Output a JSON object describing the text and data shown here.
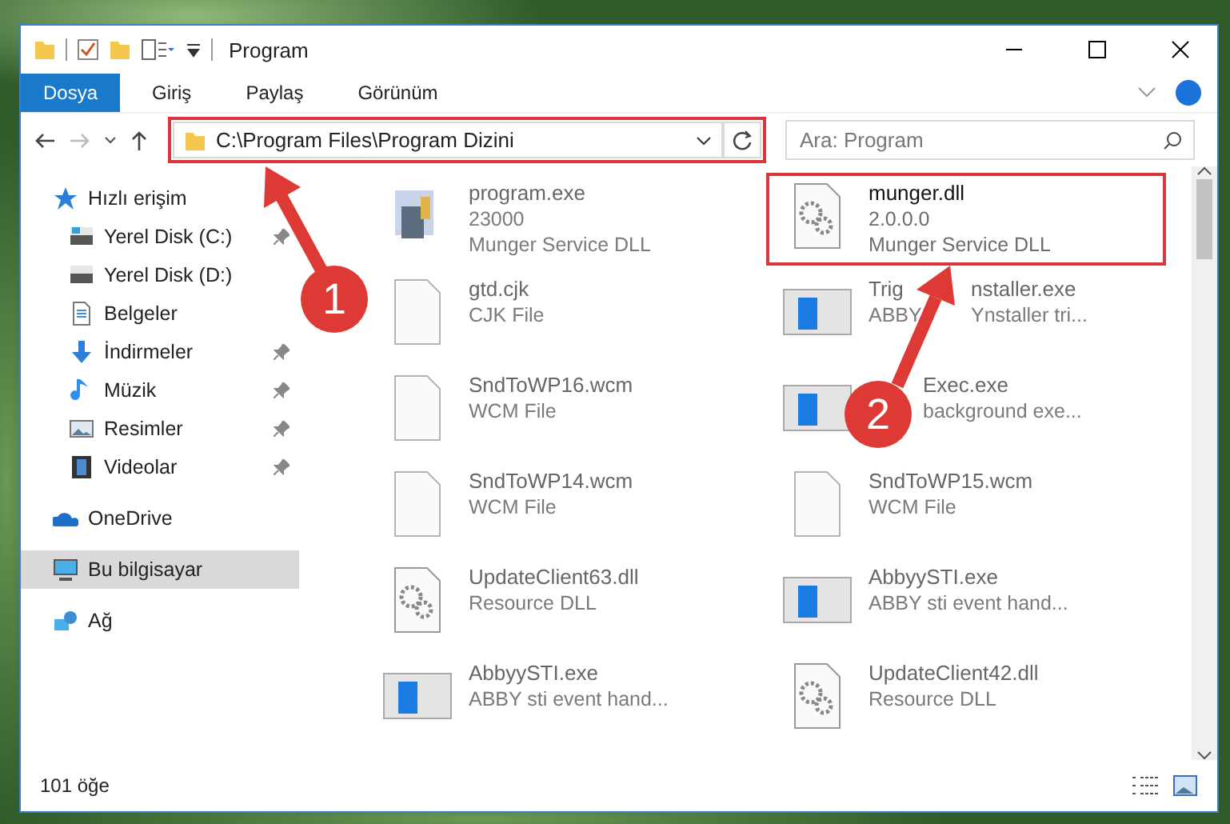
{
  "window": {
    "title": "Program"
  },
  "ribbon_tabs": [
    {
      "label": "Dosya",
      "selected": true
    },
    {
      "label": "Giriş",
      "selected": false
    },
    {
      "label": "Paylaş",
      "selected": false
    },
    {
      "label": "Görünüm",
      "selected": false
    }
  ],
  "address": {
    "path": "C:\\Program Files\\Program Dizini",
    "highlighted": true
  },
  "search": {
    "placeholder": "Ara: Program"
  },
  "sidebar": {
    "items": [
      {
        "label": "Hızlı erişim",
        "kind": "star",
        "selected": false,
        "children": [
          {
            "label": "Yerel Disk (C:)",
            "kind": "drive-c",
            "pinned": true,
            "selected": false
          },
          {
            "label": "Yerel Disk (D:)",
            "kind": "drive",
            "pinned": false,
            "selected": false
          },
          {
            "label": "Belgeler",
            "kind": "docs",
            "pinned": false,
            "selected": false
          },
          {
            "label": "İndirmeler",
            "kind": "download",
            "pinned": true,
            "selected": false
          },
          {
            "label": "Müzik",
            "kind": "music",
            "pinned": true,
            "selected": false
          },
          {
            "label": "Resimler",
            "kind": "pictures",
            "pinned": true,
            "selected": false
          },
          {
            "label": "Videolar",
            "kind": "videos",
            "pinned": true,
            "selected": false
          }
        ]
      },
      {
        "label": "OneDrive",
        "kind": "cloud",
        "selected": false
      },
      {
        "label": "Bu bilgisayar",
        "kind": "pc",
        "selected": true
      },
      {
        "label": "Ağ",
        "kind": "network",
        "selected": false
      }
    ]
  },
  "files": [
    {
      "name": [
        "program.exe"
      ],
      "lines": [
        [
          "23000"
        ],
        [
          "Munger Service DLL"
        ]
      ],
      "kind": "app",
      "dimmed": true,
      "highlighted": false
    },
    {
      "name": [
        "munger.dll"
      ],
      "lines": [
        [
          "2.0.0.0"
        ],
        [
          "Munger Service DLL"
        ]
      ],
      "kind": "dll",
      "dimmed": false,
      "highlighted": true
    },
    {
      "name": [
        "gtd.cjk"
      ],
      "lines": [
        [
          "CJK File"
        ]
      ],
      "kind": "file",
      "dimmed": true,
      "highlighted": false
    },
    {
      "name": [
        "Trig",
        "nstaller.exe"
      ],
      "lines": [
        [
          "ABBY",
          "Ynstaller tri..."
        ]
      ],
      "kind": "window",
      "dimmed": true,
      "highlighted": false
    },
    {
      "name": [
        "SndToWP16.wcm"
      ],
      "lines": [
        [
          "WCM File"
        ]
      ],
      "kind": "file",
      "dimmed": true,
      "highlighted": false
    },
    {
      "name": [
        "Exec.exe"
      ],
      "lines": [
        [
          "background exe..."
        ]
      ],
      "kind": "window",
      "dimmed": true,
      "highlighted": false
    },
    {
      "name": [
        "SndToWP14.wcm"
      ],
      "lines": [
        [
          "WCM File"
        ]
      ],
      "kind": "file",
      "dimmed": true,
      "highlighted": false
    },
    {
      "name": [
        "SndToWP15.wcm"
      ],
      "lines": [
        [
          "WCM File"
        ]
      ],
      "kind": "file",
      "dimmed": true,
      "highlighted": false
    },
    {
      "name": [
        "UpdateClient63.dll"
      ],
      "lines": [
        [
          "Resource DLL"
        ]
      ],
      "kind": "dll",
      "dimmed": true,
      "highlighted": false
    },
    {
      "name": [
        "AbbyySTI.exe"
      ],
      "lines": [
        [
          "ABBY sti event hand..."
        ]
      ],
      "kind": "window",
      "dimmed": true,
      "highlighted": false
    },
    {
      "name": [
        "AbbyySTI.exe"
      ],
      "lines": [
        [
          "ABBY sti event hand..."
        ]
      ],
      "kind": "window",
      "dimmed": true,
      "highlighted": false
    },
    {
      "name": [
        "UpdateClient42.dll"
      ],
      "lines": [
        [
          "Resource DLL"
        ]
      ],
      "kind": "dll",
      "dimmed": true,
      "highlighted": false
    }
  ],
  "status_bar": {
    "count": "101 öğe"
  },
  "annotations": [
    {
      "number": "1"
    },
    {
      "number": "2"
    }
  ]
}
